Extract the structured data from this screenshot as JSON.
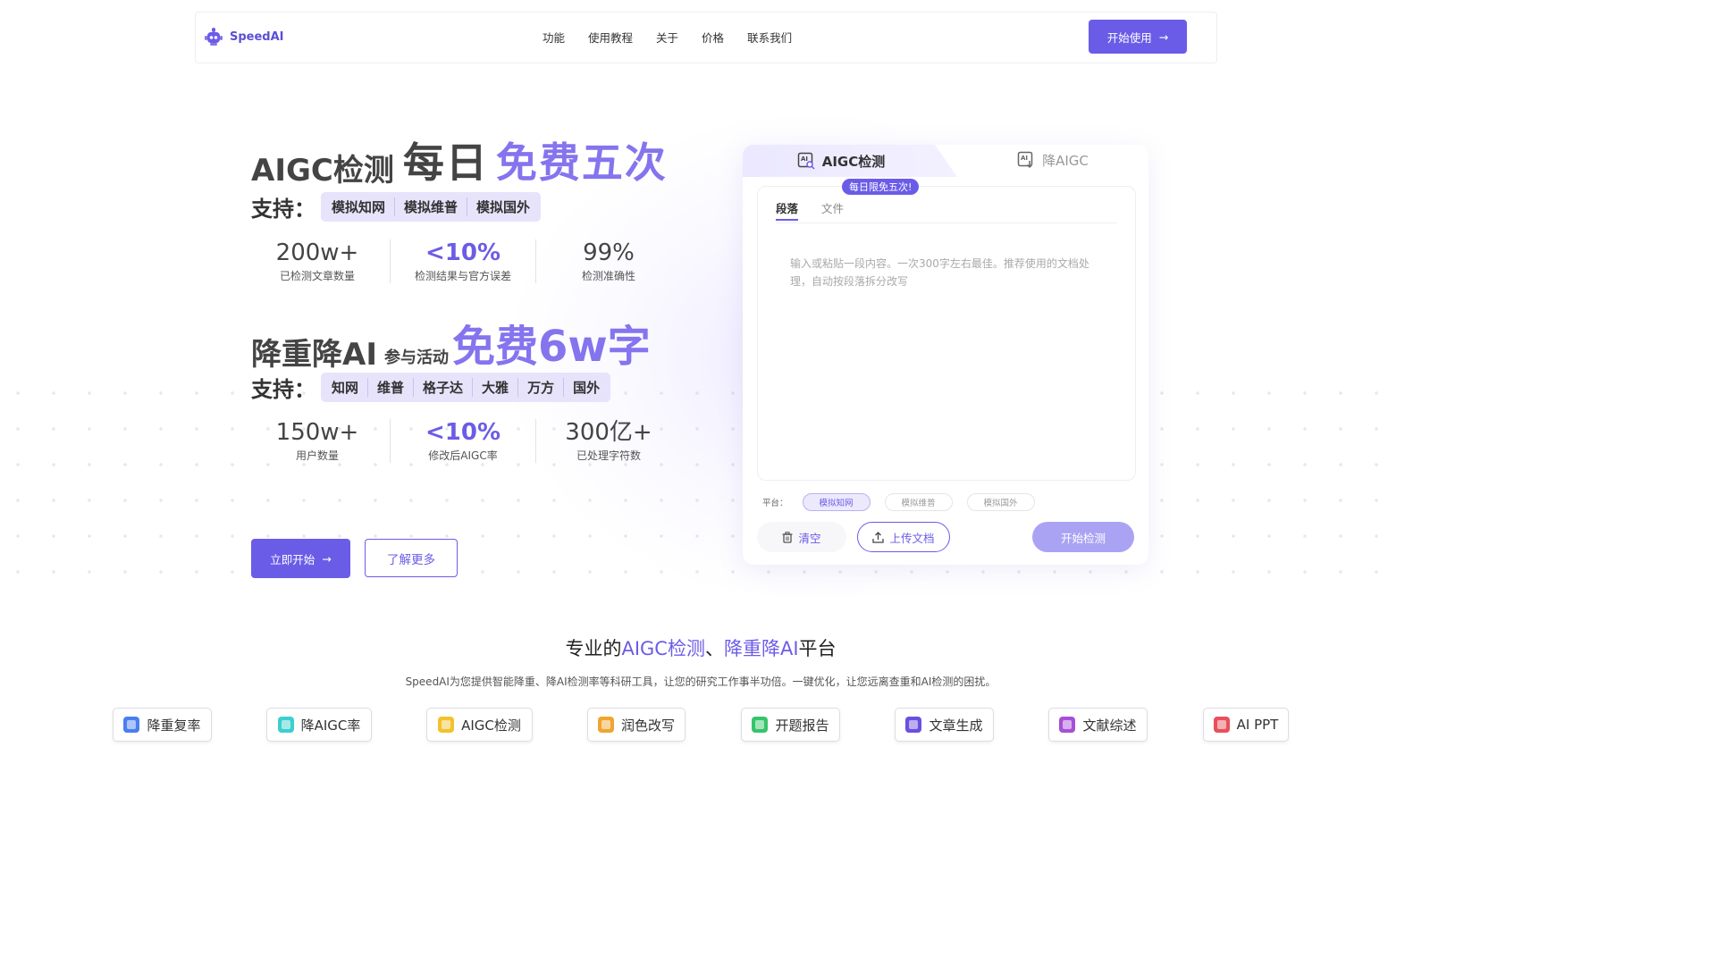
{
  "nav": {
    "brand": "SpeedAI",
    "links": [
      "功能",
      "使用教程",
      "关于",
      "价格",
      "联系我们"
    ],
    "cta": "开始使用"
  },
  "hero1": {
    "title_a": "AIGC检测",
    "title_b": "每日",
    "title_c": "免费五次",
    "support_label": "支持：",
    "tags": [
      "模拟知网",
      "模拟维普",
      "模拟国外"
    ],
    "stats": [
      {
        "value": "200w+",
        "label": "已检测文章数量"
      },
      {
        "value": "<10%",
        "label": "检测结果与官方误差"
      },
      {
        "value": "99%",
        "label": "检测准确性"
      }
    ]
  },
  "hero2": {
    "title_a": "降重降AI",
    "title_b": "参与活动",
    "title_c": "免费6w字",
    "support_label": "支持：",
    "tags": [
      "知网",
      "维普",
      "格子达",
      "大雅",
      "万方",
      "国外"
    ],
    "stats": [
      {
        "value": "150w+",
        "label": "用户数量"
      },
      {
        "value": "<10%",
        "label": "修改后AIGC率"
      },
      {
        "value": "300亿+",
        "label": "已处理字符数"
      }
    ]
  },
  "hero_buttons": {
    "primary": "立即开始",
    "secondary": "了解更多"
  },
  "panel": {
    "tab_active": "AIGC检测",
    "tab_inactive": "降AIGC",
    "icon_text": "AI",
    "badge": "每日限免五次!",
    "subtab_active": "段落",
    "subtab_inactive": "文件",
    "placeholder": "输入或粘贴一段内容。一次300字左右最佳。推荐使用的文档处理，自动按段落拆分改写",
    "platform_label": "平台：",
    "platforms": [
      "模拟知网",
      "模拟维普",
      "模拟国外"
    ],
    "clear": "清空",
    "upload": "上传文档",
    "detect": "开始检测"
  },
  "section": {
    "title_p1": "专业的",
    "title_hl1": "AIGC检测",
    "title_p2": "、",
    "title_hl2": "降重降AI",
    "title_p3": "平台",
    "desc": "SpeedAI为您提供智能降重、降AI检测率等科研工具，让您的研究工作事半功倍。一键优化，让您远离查重和AI检测的困扰。"
  },
  "features": [
    {
      "label": "降重复率",
      "color": "#4a7ef0"
    },
    {
      "label": "降AIGC率",
      "color": "#3ccfcf"
    },
    {
      "label": "AIGC检测",
      "color": "#f2c22e"
    },
    {
      "label": "润色改写",
      "color": "#f0a530"
    },
    {
      "label": "开题报告",
      "color": "#36c46a"
    },
    {
      "label": "文章生成",
      "color": "#6b4fe0"
    },
    {
      "label": "文献综述",
      "color": "#a64fd8"
    },
    {
      "label": "AI PPT",
      "color": "#e8505b"
    }
  ],
  "colors": {
    "accent": "#6b5ce7",
    "accent_light": "#8474ee"
  }
}
